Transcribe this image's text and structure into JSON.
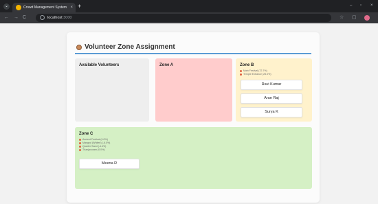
{
  "browser": {
    "tab_title": "Crowd Management System",
    "tab_close": "×",
    "new_tab": "+",
    "url_host": "localhost",
    "url_port": ":3000",
    "nav_back": "←",
    "nav_forward": "→",
    "nav_reload": "C",
    "window_min": "–",
    "window_max": "▫",
    "window_close": "×"
  },
  "page": {
    "title": "Volunteer Zone Assignment",
    "accent_color": "#5b9bd5"
  },
  "zones": {
    "available": {
      "label": "Available Volunteers",
      "color": "#eeeeee",
      "volunteers": []
    },
    "zone_a": {
      "label": "Zone A",
      "color": "#ffcccc",
      "volunteers": []
    },
    "zone_b": {
      "label": "Zone B",
      "color": "#fff2cc",
      "bullets": [
        "Main Festival (72.7%)",
        "Temple Entrance (25.0%)"
      ],
      "volunteers": [
        "Ravi Kumar",
        "Arun Raj",
        "Surya K"
      ]
    },
    "zone_c": {
      "label": "Zone C",
      "color": "#d5f0c5",
      "bullets": [
        "Ancient Festival (4.0%)",
        "Mangrol (Whiteri) (-6.0%)",
        "Quarter Sand (-4.4%)",
        "Thanjavuram (0.0%)"
      ],
      "volunteers": [
        "Meena R"
      ]
    }
  }
}
